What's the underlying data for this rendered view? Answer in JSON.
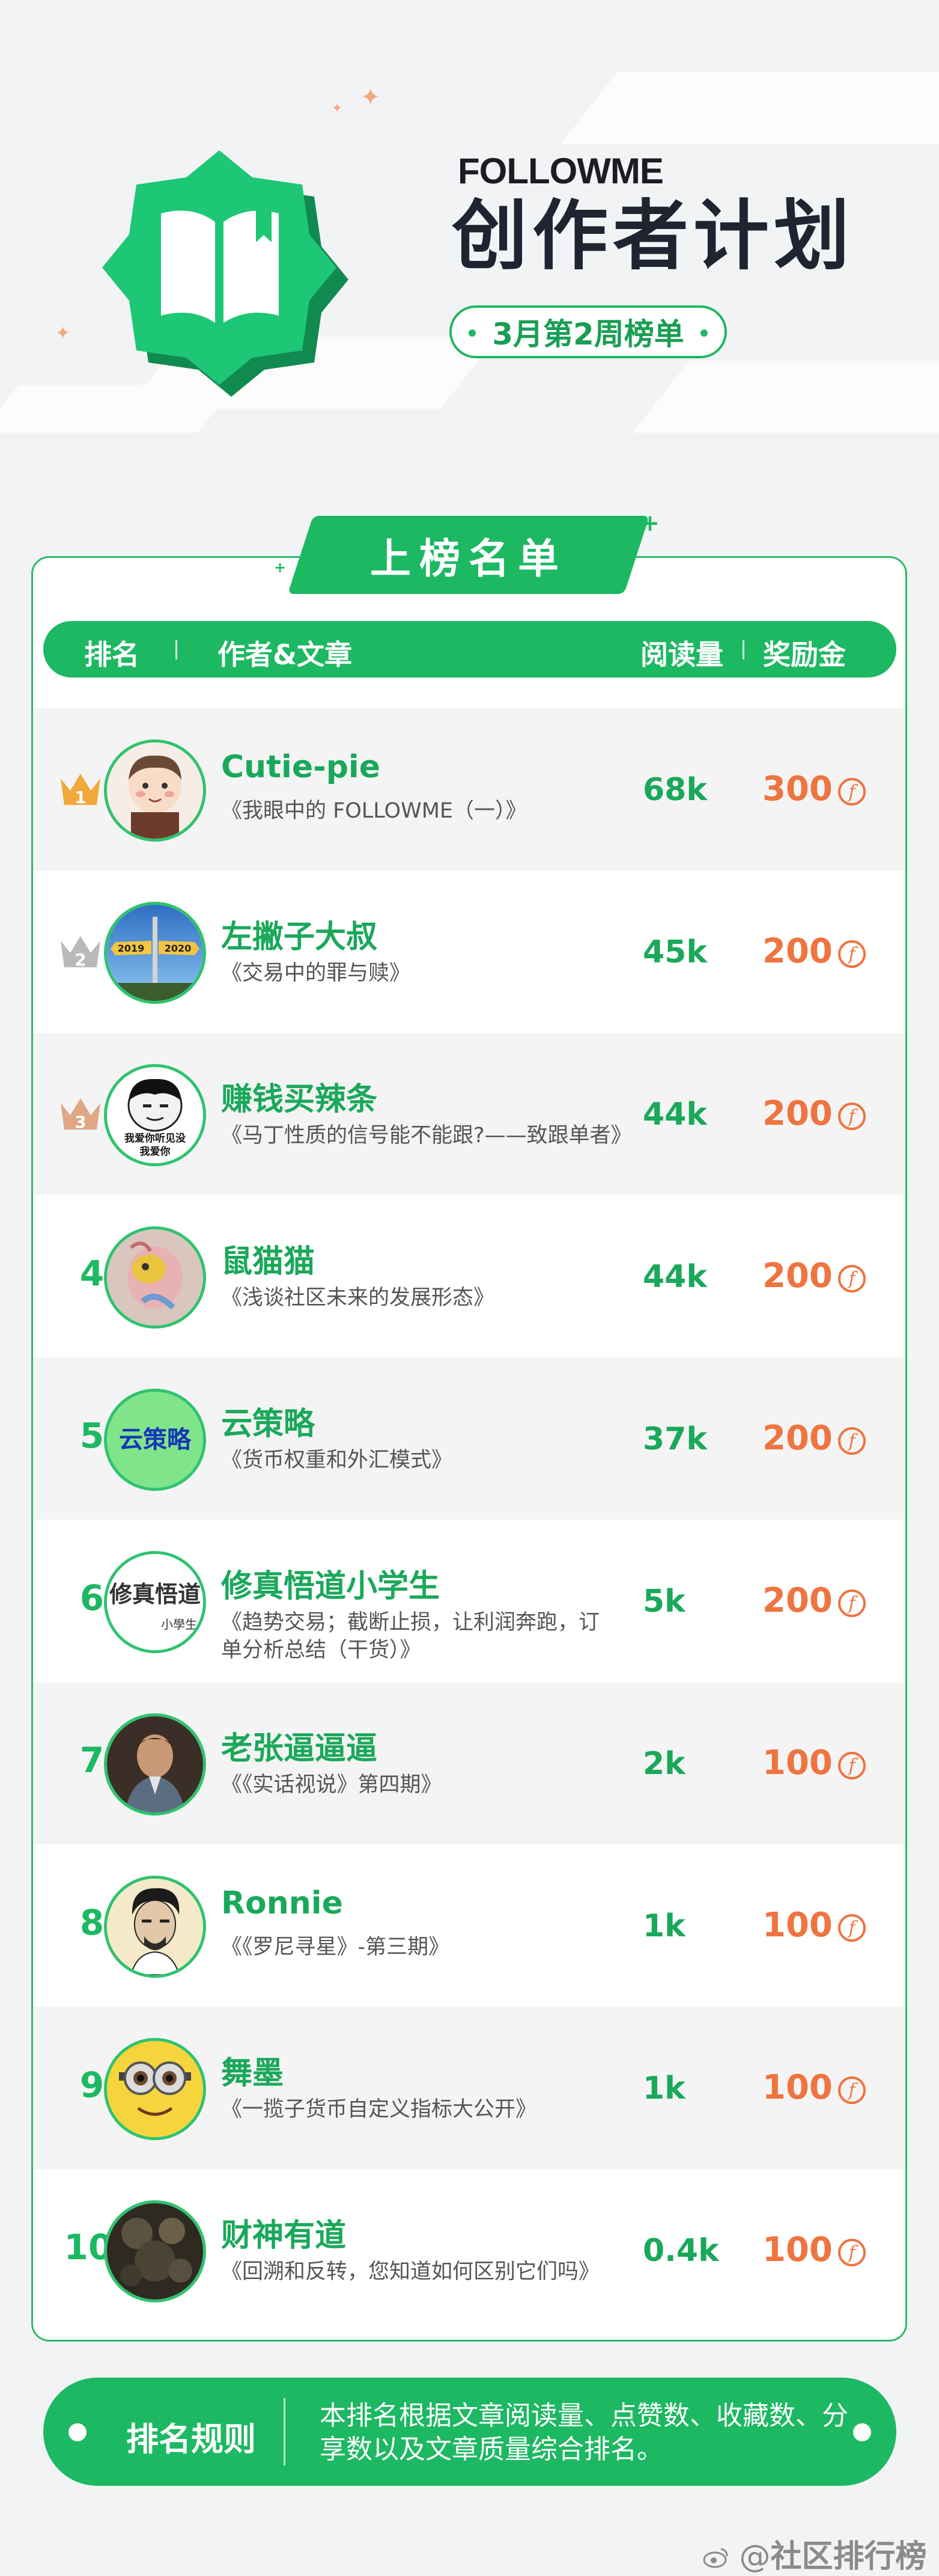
{
  "header": {
    "brand": "FOLLOWME",
    "title": "创作者计划",
    "week_badge": "3月第2周榜单"
  },
  "board": {
    "tab_title": "上榜名单",
    "columns": {
      "rank": "排名",
      "author": "作者&文章",
      "reads": "阅读量",
      "bonus": "奖励金"
    }
  },
  "rows": [
    {
      "rank": "1",
      "name": "Cutie-pie",
      "article": "《我眼中的 FOLLOWME（一）》",
      "reads": "68k",
      "bonus": "300"
    },
    {
      "rank": "2",
      "name": "左撇子大叔",
      "article": "《交易中的罪与赎》",
      "reads": "45k",
      "bonus": "200"
    },
    {
      "rank": "3",
      "name": "赚钱买辣条",
      "article": "《马丁性质的信号能不能跟?——致跟单者》",
      "reads": "44k",
      "bonus": "200"
    },
    {
      "rank": "4",
      "name": "鼠猫猫",
      "article": "《浅谈社区未来的发展形态》",
      "reads": "44k",
      "bonus": "200"
    },
    {
      "rank": "5",
      "name": "云策略",
      "article": "《货币权重和外汇模式》",
      "reads": "37k",
      "bonus": "200"
    },
    {
      "rank": "6",
      "name": "修真悟道小学生",
      "article": "《趋势交易；截断止损，让利润奔跑，订单分析总结（干货）》",
      "reads": "5k",
      "bonus": "200"
    },
    {
      "rank": "7",
      "name": "老张逼逼逼",
      "article": "《《实话视说》第四期》",
      "reads": "2k",
      "bonus": "100"
    },
    {
      "rank": "8",
      "name": "Ronnie",
      "article": "《《罗尼寻星》-第三期》",
      "reads": "1k",
      "bonus": "100"
    },
    {
      "rank": "9",
      "name": "舞墨",
      "article": "《一揽子货币自定义指标大公开》",
      "reads": "1k",
      "bonus": "100"
    },
    {
      "rank": "10",
      "name": "财神有道",
      "article": "《回溯和反转，您知道如何区别它们吗》",
      "reads": "0.4k",
      "bonus": "100"
    }
  ],
  "avatar_text": {
    "a2_left": "2019",
    "a2_right": "2020",
    "a3_caption_1": "我爱你听见没",
    "a3_caption_2": "我爱你",
    "a5_text": "云策略",
    "a6_text": "修真悟道",
    "a6_sub": "小學生"
  },
  "rules": {
    "label": "排名规则",
    "text": "本排名根据文章阅读量、点赞数、收藏数、分享数以及文章质量综合排名。"
  },
  "watermark": {
    "prefix": "@",
    "text": "社区排行榜"
  },
  "colors": {
    "primary_green": "#1db862",
    "bonus_orange": "#ee7440",
    "gold": "#f1a93b",
    "silver": "#b9b9b9",
    "bronze": "#e0a784"
  }
}
